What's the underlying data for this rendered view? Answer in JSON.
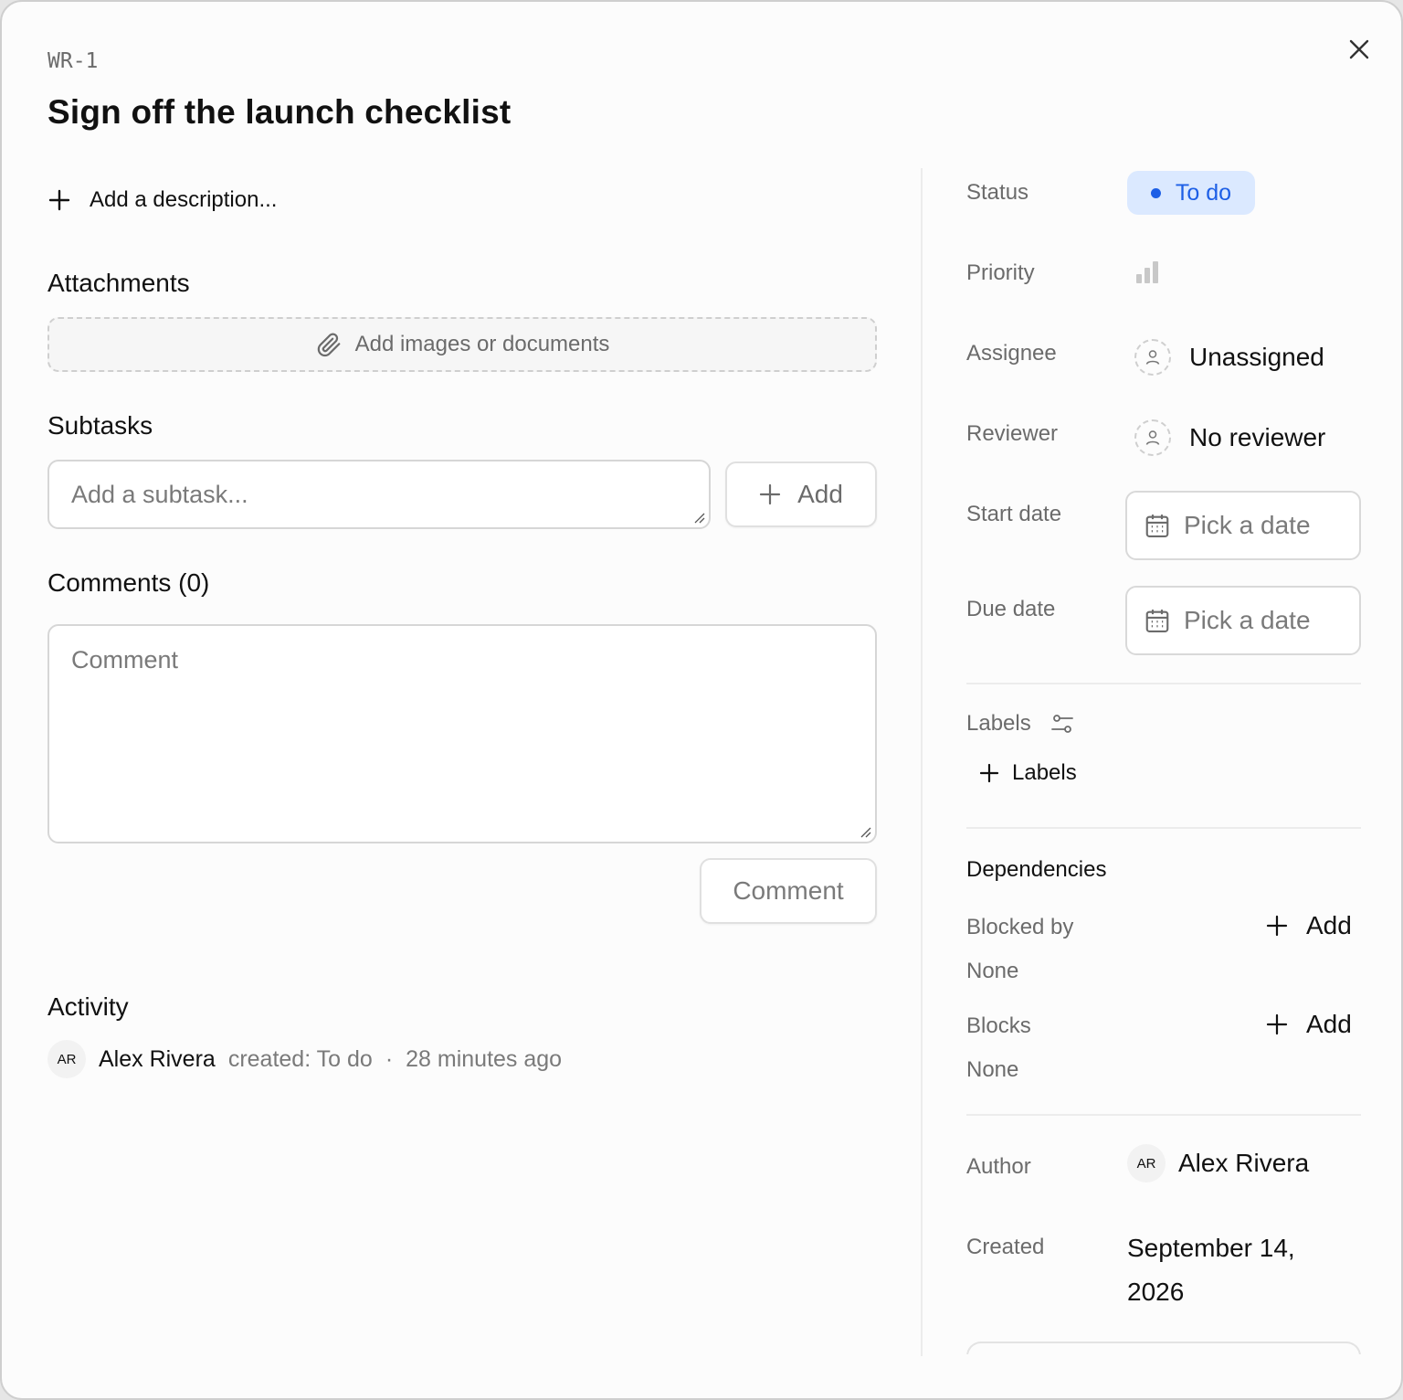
{
  "issue": {
    "key": "WR-1",
    "title": "Sign off the launch checklist"
  },
  "description": {
    "add_label": "Add a description..."
  },
  "attachments": {
    "heading": "Attachments",
    "placeholder": "Add images or documents"
  },
  "subtasks": {
    "heading": "Subtasks",
    "placeholder": "Add a subtask...",
    "add_label": "Add"
  },
  "comments": {
    "heading": "Comments (0)",
    "placeholder": "Comment",
    "submit_label": "Comment"
  },
  "activity": {
    "heading": "Activity",
    "items": [
      {
        "initials": "AR",
        "name": "Alex Rivera",
        "action": "created: To do",
        "separator": "·",
        "time": "28 minutes ago"
      }
    ]
  },
  "sidebar": {
    "status": {
      "label": "Status",
      "value": "To do",
      "color": "#1d5fe6"
    },
    "priority": {
      "label": "Priority",
      "icon": "priority-bars-icon"
    },
    "assignee": {
      "label": "Assignee",
      "value": "Unassigned",
      "icon": "user-icon"
    },
    "reviewer": {
      "label": "Reviewer",
      "value": "No reviewer",
      "icon": "user-icon"
    },
    "start_date": {
      "label": "Start date",
      "value": "Pick a date",
      "icon": "calendar-icon"
    },
    "due_date": {
      "label": "Due date",
      "value": "Pick a date",
      "icon": "calendar-icon"
    },
    "labels": {
      "label": "Labels",
      "add_label": "Labels",
      "icon": "sliders-icon"
    },
    "dependencies": {
      "heading": "Dependencies",
      "blocked_by": {
        "label": "Blocked by",
        "add_label": "Add",
        "value": "None"
      },
      "blocks": {
        "label": "Blocks",
        "add_label": "Add",
        "value": "None"
      }
    },
    "author": {
      "label": "Author",
      "initials": "AR",
      "name": "Alex Rivera"
    },
    "created": {
      "label": "Created",
      "value": "September 14, 2026"
    }
  }
}
